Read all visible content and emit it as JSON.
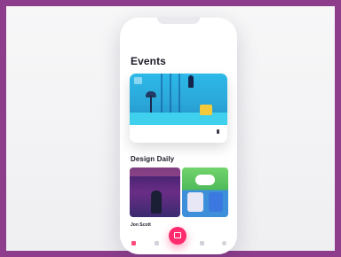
{
  "app": {
    "events_title": "Events",
    "event_caption": "",
    "daily_title": "Design Daily",
    "author_name": "Jon Scott",
    "author_sub": "",
    "stats": ""
  },
  "colors": {
    "frame": "#8e3d8c",
    "accent": "#ff2b6e",
    "event_blue": "#2db9e8"
  },
  "icons": {
    "home": "home-icon",
    "search": "search-icon",
    "add": "calendar-icon",
    "bell": "bell-icon",
    "profile": "profile-icon"
  }
}
